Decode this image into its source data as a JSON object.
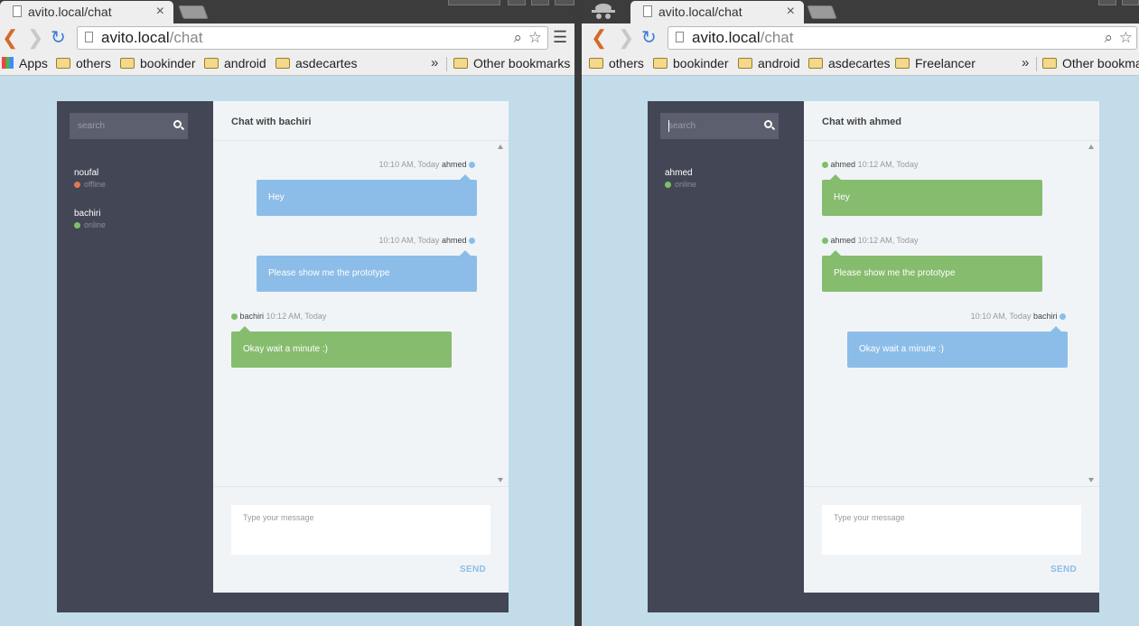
{
  "left": {
    "tab_title": "avito.local/chat",
    "url_host": "avito.local",
    "url_path": "/chat",
    "bookmarks": [
      "Apps",
      "others",
      "bookinder",
      "android",
      "asdecartes"
    ],
    "other_bookmarks": "Other bookmarks",
    "chevron": "»",
    "chat": {
      "search_placeholder": "search",
      "contacts": [
        {
          "name": "noufal",
          "status": "offline"
        },
        {
          "name": "bachiri",
          "status": "online"
        }
      ],
      "header": "Chat with bachiri",
      "messages": [
        {
          "time": "10:10 AM, Today",
          "name": "ahmed",
          "text": "Hey",
          "side": "right"
        },
        {
          "time": "10:10 AM, Today",
          "name": "ahmed",
          "text": "Please show me the prototype",
          "side": "right"
        },
        {
          "time": "10:12 AM, Today",
          "name": "bachiri",
          "text": "Okay wait a minute :)",
          "side": "left"
        }
      ],
      "compose_placeholder": "Type your message",
      "send_label": "SEND"
    }
  },
  "right": {
    "tab_title": "avito.local/chat",
    "url_host": "avito.local",
    "url_path": "/chat",
    "bookmarks": [
      "others",
      "bookinder",
      "android",
      "asdecartes",
      "Freelancer"
    ],
    "other_bookmarks": "Other bookma",
    "chevron": "»",
    "chat": {
      "search_placeholder": "search",
      "contacts": [
        {
          "name": "ahmed",
          "status": "online"
        }
      ],
      "header": "Chat with ahmed",
      "messages": [
        {
          "time": "10:12 AM, Today",
          "name": "ahmed",
          "text": "Hey",
          "side": "left"
        },
        {
          "time": "10:12 AM, Today",
          "name": "ahmed",
          "text": "Please show me the prototype",
          "side": "left"
        },
        {
          "time": "10:10 AM, Today",
          "name": "bachiri",
          "text": "Okay wait a minute :)",
          "side": "right"
        }
      ],
      "compose_placeholder": "Type your message",
      "send_label": "SEND"
    }
  },
  "colors": {
    "desktop_bg": "#c2dcea",
    "sidebar": "#434654",
    "panel": "#f0f4f7",
    "bubble_blue": "#8cbde8",
    "bubble_green": "#86bc6e",
    "online": "#7fbf6a",
    "offline": "#e07856",
    "reload_blue": "#3b7dd8",
    "back_orange": "#d56a28"
  }
}
